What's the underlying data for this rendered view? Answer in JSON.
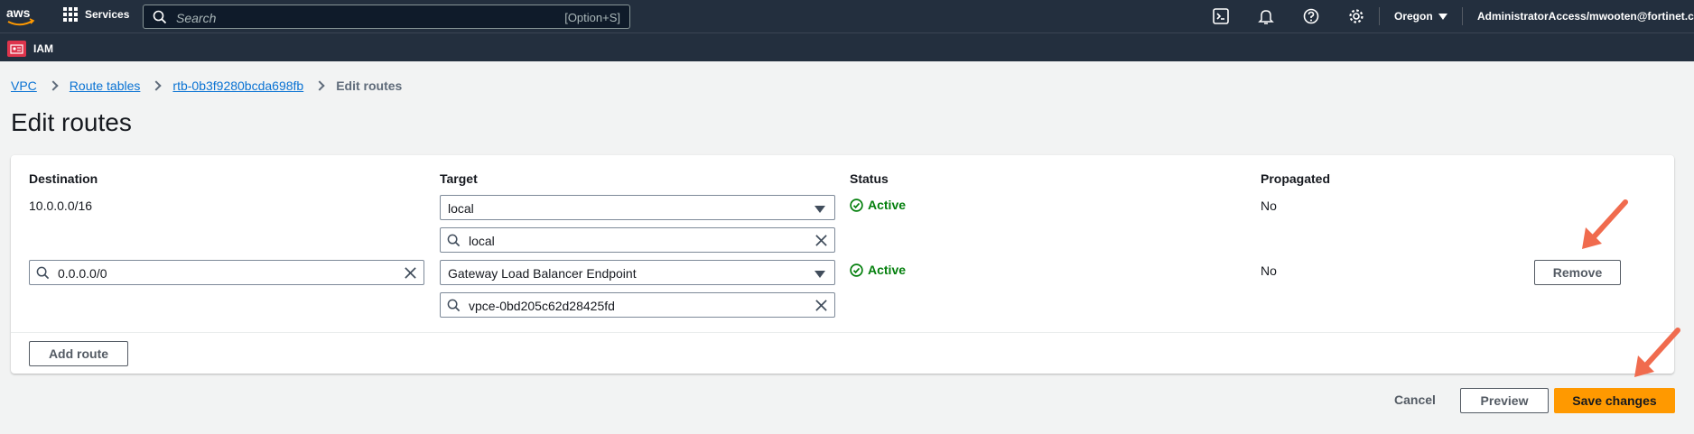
{
  "topnav": {
    "logo_text": "aws",
    "services_label": "Services",
    "search_placeholder": "Search",
    "search_shortcut": "[Option+S]",
    "region": "Oregon",
    "account": "AdministratorAccess/mwooten@fortinet.co"
  },
  "subnav": {
    "service_label": "IAM"
  },
  "breadcrumb": {
    "items": [
      "VPC",
      "Route tables",
      "rtb-0b3f9280bcda698fb"
    ],
    "current": "Edit routes"
  },
  "page_title": "Edit routes",
  "table": {
    "headers": {
      "destination": "Destination",
      "target": "Target",
      "status": "Status",
      "propagated": "Propagated"
    },
    "rows": [
      {
        "destination": "10.0.0.0/16",
        "target_type": "local",
        "target_value": "local",
        "status": "Active",
        "propagated": "No"
      },
      {
        "destination": "0.0.0.0/0",
        "target_type": "Gateway Load Balancer Endpoint",
        "target_value": "vpce-0bd205c62d28425fd",
        "status": "Active",
        "propagated": "No",
        "remove_label": "Remove"
      }
    ]
  },
  "add_route_label": "Add route",
  "footer": {
    "cancel": "Cancel",
    "preview": "Preview",
    "save": "Save changes"
  },
  "colors": {
    "nav": "#232f3e",
    "link": "#0972d3",
    "status_active": "#037f0c",
    "primary": "#ff9900",
    "annotation_arrow": "#f06b4e"
  }
}
